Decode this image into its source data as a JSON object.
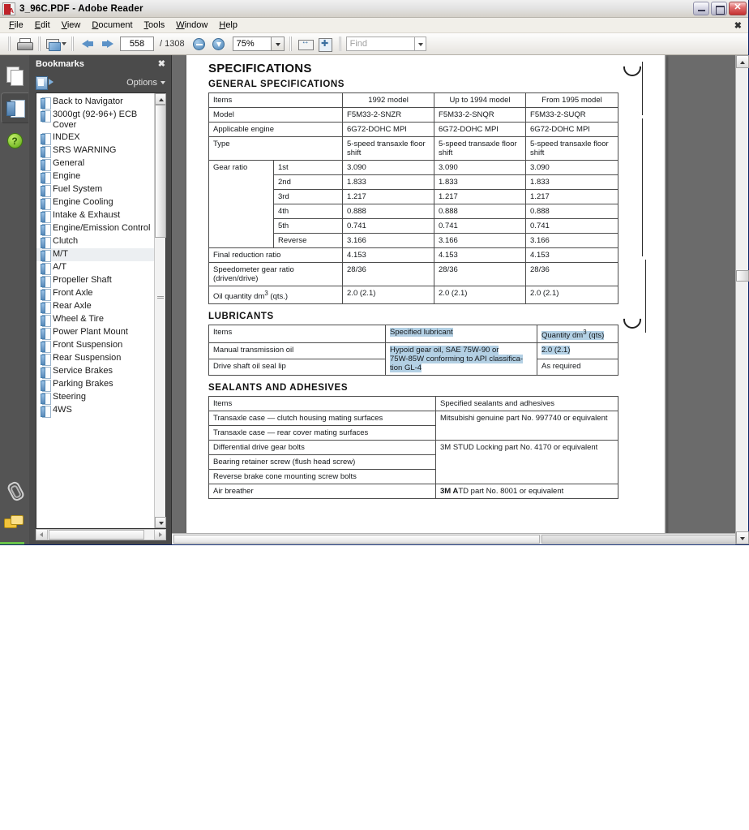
{
  "window": {
    "title": "3_96C.PDF - Adobe Reader",
    "app_icon": "pdf-document-icon",
    "controls": {
      "minimize": "minimize",
      "maximize": "restore",
      "close": "close"
    }
  },
  "menubar": {
    "items": [
      {
        "label": "File",
        "accel": "F"
      },
      {
        "label": "Edit",
        "accel": "E"
      },
      {
        "label": "View",
        "accel": "V"
      },
      {
        "label": "Document",
        "accel": "D"
      },
      {
        "label": "Tools",
        "accel": "T"
      },
      {
        "label": "Window",
        "accel": "W"
      },
      {
        "label": "Help",
        "accel": "H"
      }
    ],
    "close_label": "✖"
  },
  "toolbar": {
    "print_title": "Print",
    "email_title": "Email",
    "prev_title": "Previous Page",
    "next_title": "Next Page",
    "page_number": "558",
    "page_total": "/ 1308",
    "zoom_out_title": "Zoom Out",
    "zoom_in_title": "Zoom In",
    "zoom_value": "75%",
    "fit_width_title": "Fit Width",
    "fit_page_title": "Fit Page",
    "find_placeholder": "Find"
  },
  "rail": {
    "items": [
      {
        "name": "pages-panel",
        "label": "Pages"
      },
      {
        "name": "bookmarks-panel",
        "label": "Bookmarks"
      },
      {
        "name": "help-panel",
        "label": "Help"
      }
    ],
    "bottom_items": [
      {
        "name": "attachments-panel",
        "label": "Attachments"
      },
      {
        "name": "comments-panel",
        "label": "Comments"
      }
    ]
  },
  "bookmarks": {
    "title": "Bookmarks",
    "close_label": "✖",
    "new_bookmark_title": "New Bookmark",
    "options_label": "Options",
    "items": [
      {
        "label": "Back to Navigator",
        "selected": false
      },
      {
        "label": "3000gt (92-96+) ECB Cover",
        "selected": false
      },
      {
        "label": "INDEX",
        "selected": false
      },
      {
        "label": "SRS WARNING",
        "selected": false
      },
      {
        "label": "General",
        "selected": false
      },
      {
        "label": "Engine",
        "selected": false
      },
      {
        "label": "Fuel System",
        "selected": false
      },
      {
        "label": "Engine Cooling",
        "selected": false
      },
      {
        "label": "Intake & Exhaust",
        "selected": false
      },
      {
        "label": "Engine/Emission Control",
        "selected": false
      },
      {
        "label": "Clutch",
        "selected": false
      },
      {
        "label": "M/T",
        "selected": true
      },
      {
        "label": "A/T",
        "selected": false
      },
      {
        "label": "Propeller Shaft",
        "selected": false
      },
      {
        "label": "Front Axle",
        "selected": false
      },
      {
        "label": "Rear Axle",
        "selected": false
      },
      {
        "label": "Wheel & Tire",
        "selected": false
      },
      {
        "label": "Power Plant Mount",
        "selected": false
      },
      {
        "label": "Front Suspension",
        "selected": false
      },
      {
        "label": "Rear Suspension",
        "selected": false
      },
      {
        "label": "Service Brakes",
        "selected": false
      },
      {
        "label": "Parking Brakes",
        "selected": false
      },
      {
        "label": "Steering",
        "selected": false
      },
      {
        "label": "4WS",
        "selected": false
      }
    ]
  },
  "document": {
    "title": "SPECIFICATIONS",
    "general": {
      "heading": "GENERAL   SPECIFICATIONS",
      "columns": [
        "Items",
        "1992 model",
        "Up to 1994 model",
        "From 1995 model"
      ],
      "rows": [
        {
          "item": "Model",
          "values": [
            "F5M33-2-SNZR",
            "F5M33-2-SNQR",
            "F5M33-2-SUQR"
          ]
        },
        {
          "item": "Applicable engine",
          "values": [
            "6G72-DOHC MPI",
            "6G72-DOHC MPI",
            "6G72-DOHC MPI"
          ]
        },
        {
          "item": "Type",
          "values": [
            "5-speed transaxle floor shift",
            "5-speed transaxle floor shift",
            "5-speed transaxle floor shift"
          ]
        }
      ],
      "gear_ratio_label": "Gear ratio",
      "gear_rows": [
        {
          "gear": "1st",
          "values": [
            "3.090",
            "3.090",
            "3.090"
          ]
        },
        {
          "gear": "2nd",
          "values": [
            "1.833",
            "1.833",
            "1.833"
          ]
        },
        {
          "gear": "3rd",
          "values": [
            "1.217",
            "1.217",
            "1.217"
          ]
        },
        {
          "gear": "4th",
          "values": [
            "0.888",
            "0.888",
            "0.888"
          ]
        },
        {
          "gear": "5th",
          "values": [
            "0.741",
            "0.741",
            "0.741"
          ]
        },
        {
          "gear": "Reverse",
          "values": [
            "3.166",
            "3.166",
            "3.166"
          ]
        }
      ],
      "tail_rows": [
        {
          "item": "Final reduction ratio",
          "values": [
            "4.153",
            "4.153",
            "4.153"
          ]
        },
        {
          "item": "Speedometer gear ratio (driven/drive)",
          "values": [
            "28/36",
            "28/36",
            "28/36"
          ]
        },
        {
          "item": "Oil quantity dm³ (qts.)",
          "values": [
            "2.0 (2.1)",
            "2.0 (2.1)",
            "2.0 (2.1)"
          ]
        }
      ]
    },
    "lubricants": {
      "heading": "LUBRICANTS",
      "columns": [
        "Items",
        "Specified   lubricant",
        "Quantity dm³ (qts)"
      ],
      "rows": [
        {
          "item": "Manual transmission oil",
          "lubricant_line1": "Hypoid  gear  oil,  SAE  75W-90  or",
          "lubricant_line2": "75W-85W conforming to API classifica-",
          "lubricant_line3": "tion  GL-4",
          "quantity": "2.0  (2.1)"
        },
        {
          "item": "Drive shaft oil seal lip",
          "lubricant": "",
          "quantity": "As  required"
        }
      ]
    },
    "sealants": {
      "heading": "SEALANTS  AND  ADHESIVES",
      "columns": [
        "Items",
        "Specified sealants and adhesives"
      ],
      "rows": [
        {
          "item": "Transaxle case — clutch housing mating surfaces",
          "value": "Mitsubishi  genuine  part  No.  997740  or  equivalent"
        },
        {
          "item": "Transaxle case — rear cover mating surfaces",
          "value": ""
        },
        {
          "item": "Differential drive gear bolts",
          "value": "3M  STUD  Locking  part  No.  4170  or  equivalent"
        },
        {
          "item": "Bearing retainer screw (flush head screw)",
          "value": ""
        },
        {
          "item": "Reverse brake cone mounting screw bolts",
          "value": ""
        },
        {
          "item": "Air breather",
          "value": "3M ATD part No. 8001 or equivalent"
        }
      ]
    }
  },
  "colors": {
    "selection_highlight": "#b3d0e4",
    "panel_dark": "#4b4b4b",
    "viewport_gray": "#6b6b6b",
    "accent_blue": "#5c92c7"
  }
}
